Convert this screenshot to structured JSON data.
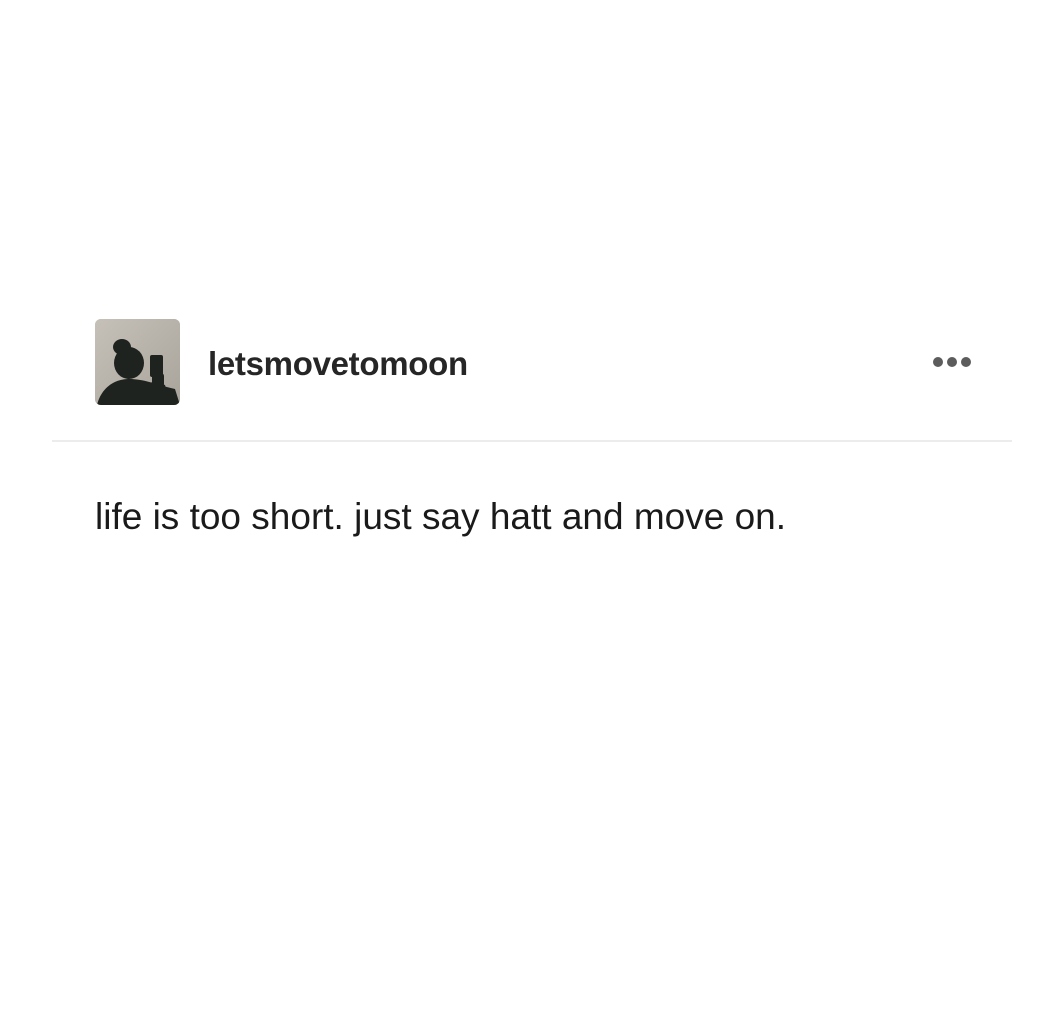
{
  "post": {
    "author": {
      "username": "letsmovetomoon",
      "avatar_icon": "silhouette-selfie-avatar"
    },
    "menu_icon": "more-options-icon",
    "body": "life is too short. just say hatt and move on."
  },
  "colors": {
    "background": "#ffffff",
    "text": "#1a1a1a",
    "divider": "#ececec",
    "menu_dots": "#5c5c5c"
  }
}
